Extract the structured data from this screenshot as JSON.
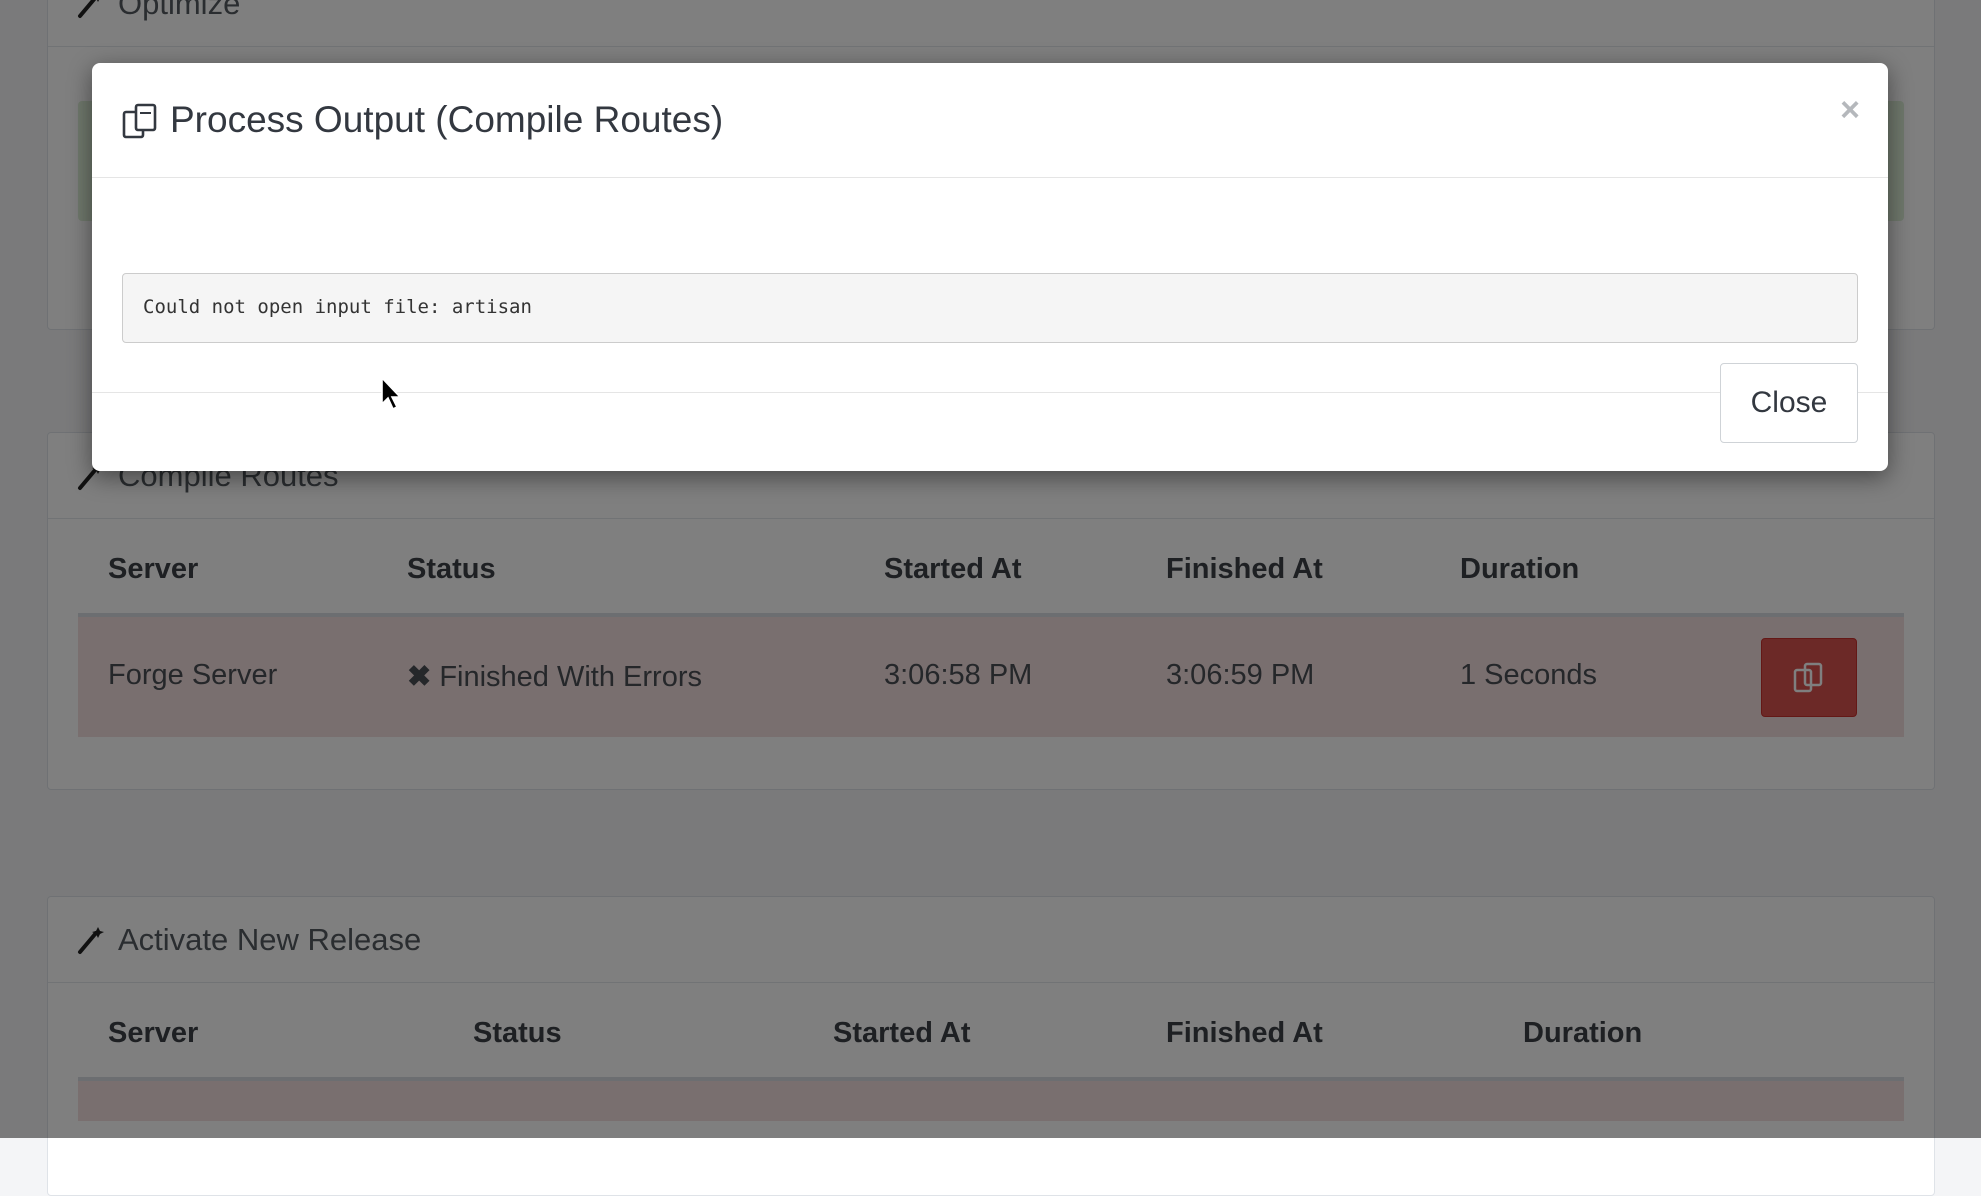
{
  "background": {
    "panels": [
      {
        "title": "Optimize",
        "icon": "magic-wand-icon"
      },
      {
        "title": "Compile Routes",
        "icon": "magic-wand-icon",
        "columns": [
          "Server",
          "Status",
          "Started At",
          "Finished At",
          "Duration"
        ],
        "rows": [
          {
            "server": "Forge Server",
            "status_icon": "x-icon",
            "status": "Finished With Errors",
            "started_at": "3:06:58 PM",
            "finished_at": "3:06:59 PM",
            "duration": "1 Seconds",
            "action_icon": "output-copy-icon"
          }
        ]
      },
      {
        "title": "Activate New Release",
        "icon": "magic-wand-icon",
        "columns": [
          "Server",
          "Status",
          "Started At",
          "Finished At",
          "Duration"
        ]
      }
    ]
  },
  "modal": {
    "title": "Process Output (Compile Routes)",
    "title_icon": "output-copy-icon",
    "close_symbol": "×",
    "output_text": "Could not open input file: artisan",
    "close_button_label": "Close"
  },
  "colors": {
    "error_row": "#f2dede",
    "danger_button": "#d9534f",
    "backdrop": "rgba(0,0,0,0.5)"
  }
}
